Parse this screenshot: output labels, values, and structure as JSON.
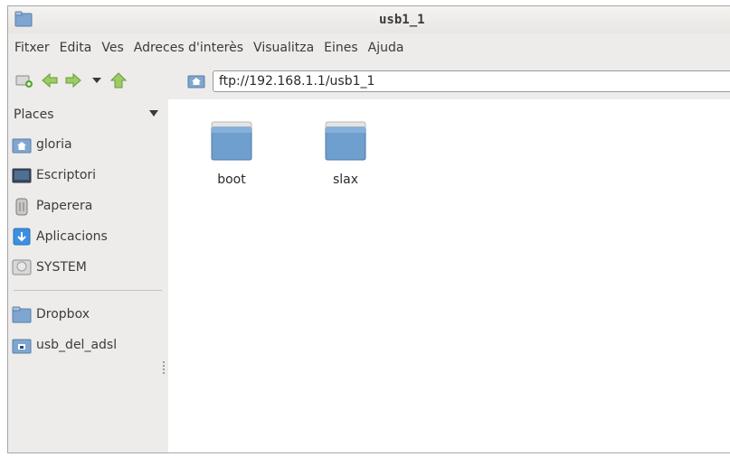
{
  "window": {
    "title": "usb1_1"
  },
  "menubar": {
    "items": [
      "Fitxer",
      "Edita",
      "Ves",
      "Adreces d'interès",
      "Visualitza",
      "Eines",
      "Ajuda"
    ]
  },
  "location": {
    "value": "ftp://192.168.1.1/usb1_1"
  },
  "sidebar": {
    "header": "Places",
    "items": [
      {
        "label": "gloria",
        "icon": "home-folder-icon"
      },
      {
        "label": "Escriptori",
        "icon": "desktop-icon"
      },
      {
        "label": "Paperera",
        "icon": "trash-icon"
      },
      {
        "label": "Aplicacions",
        "icon": "applications-icon"
      },
      {
        "label": "SYSTEM",
        "icon": "drive-icon"
      },
      {
        "label": "Dropbox",
        "icon": "folder-icon"
      },
      {
        "label": "usb_del_adsl",
        "icon": "network-folder-icon"
      }
    ]
  },
  "files": [
    {
      "name": "boot",
      "icon": "folder-icon"
    },
    {
      "name": "slax",
      "icon": "folder-icon"
    }
  ],
  "colors": {
    "folder": "#6f9fcf",
    "accent": "#4a90d9",
    "arrows": "#8bc34a"
  }
}
